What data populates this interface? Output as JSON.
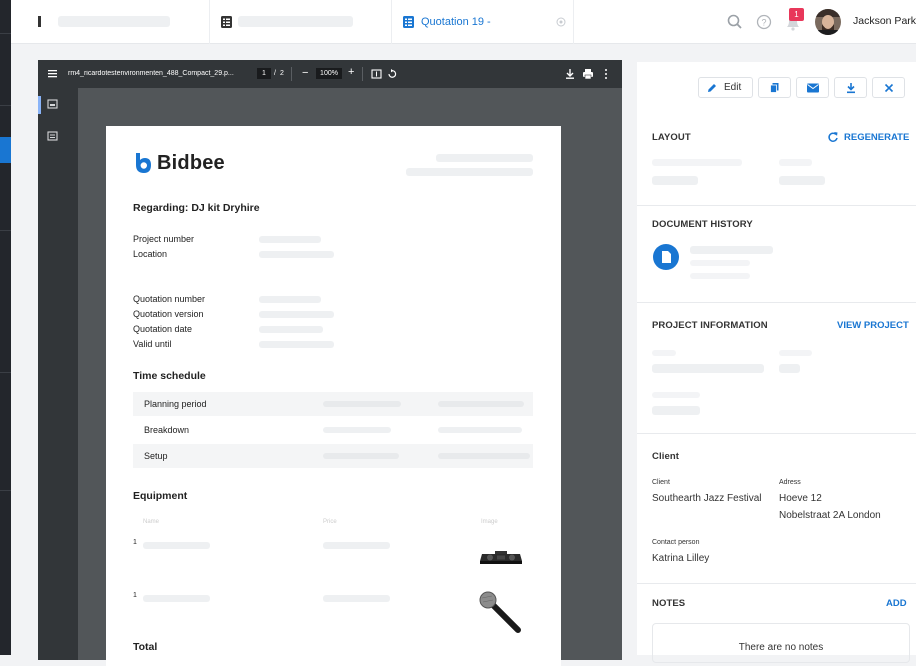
{
  "header": {
    "tabs": [
      {
        "label": ""
      },
      {
        "label": ""
      },
      {
        "label": "Quotation 19 -"
      }
    ],
    "notification_count": "1",
    "user_name": "Jackson Parke"
  },
  "pdf_viewer": {
    "filename": "rm4_ricardotestenvironmenten_488_Compact_29.p...",
    "page_current": "1",
    "page_separator": "/",
    "page_total": "2",
    "zoom": "100%"
  },
  "document": {
    "logo": "Bidbee",
    "regarding": "Regarding: DJ kit Dryhire",
    "fields_project": [
      "Project number",
      "Location"
    ],
    "fields_quote": [
      "Quotation number",
      "Quotation version",
      "Quotation date",
      "Valid until"
    ],
    "time_schedule": {
      "title": "Time schedule",
      "rows": [
        "Planning period",
        "Breakdown",
        "Setup"
      ]
    },
    "equipment": {
      "title": "Equipment",
      "columns": [
        "Name",
        "Price",
        "Image"
      ],
      "rows": [
        {
          "qty": "1",
          "image": "dj-controller"
        },
        {
          "qty": "1",
          "image": "microphone"
        }
      ]
    },
    "total": "Total"
  },
  "panel": {
    "actions": {
      "edit": "Edit"
    },
    "layout": {
      "title": "LAYOUT",
      "action": "REGENERATE"
    },
    "history": {
      "title": "DOCUMENT HISTORY"
    },
    "project": {
      "title": "PROJECT INFORMATION",
      "action": "VIEW PROJECT"
    },
    "client": {
      "title": "Client",
      "client_label": "Client",
      "client_value": "Southearth Jazz Festival",
      "address_label": "Adress",
      "address_line1": "Hoeve 12",
      "address_line2": "Nobelstraat 2A London",
      "contact_label": "Contact person",
      "contact_value": "Katrina Lilley"
    },
    "notes": {
      "title": "NOTES",
      "action": "ADD",
      "empty": "There are no notes"
    }
  },
  "colors": {
    "accent": "#1976d2",
    "badge": "#e8375a",
    "dark": "#323639"
  }
}
